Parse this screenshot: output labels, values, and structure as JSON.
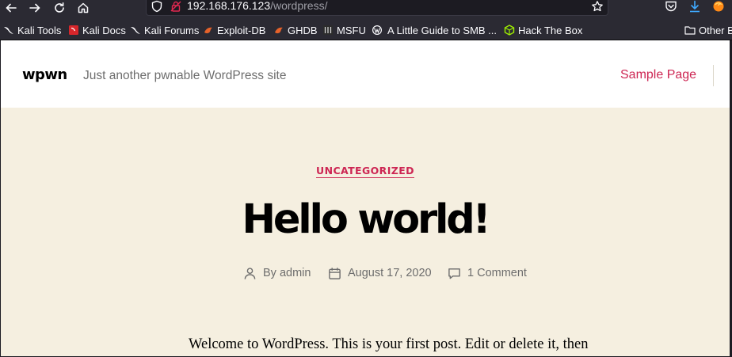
{
  "browser": {
    "url_host": "192.168.176.123",
    "url_path": "/wordpress/",
    "bookmarks": [
      {
        "label": "Kali Tools",
        "icon": "kali-dragon-icon"
      },
      {
        "label": "Kali Docs",
        "icon": "kali-docs-icon"
      },
      {
        "label": "Kali Forums",
        "icon": "kali-dragon-icon"
      },
      {
        "label": "Exploit-DB",
        "icon": "exploit-db-icon"
      },
      {
        "label": "GHDB",
        "icon": "ghdb-icon"
      },
      {
        "label": "MSFU",
        "icon": "msfu-icon"
      },
      {
        "label": "A Little Guide to SMB ...",
        "icon": "wordpress-icon"
      },
      {
        "label": "Hack The Box",
        "icon": "hackthebox-icon"
      },
      {
        "label": "Other B",
        "icon": "folder-icon"
      }
    ]
  },
  "site": {
    "title": "wpwn",
    "description": "Just another pwnable WordPress site",
    "menu": [
      "Sample Page"
    ]
  },
  "post": {
    "category": "UNCATEGORIZED",
    "title": "Hello world!",
    "author": "By admin",
    "date": "August 17, 2020",
    "comments": "1 Comment",
    "excerpt": "Welcome to WordPress. This is your first post. Edit or delete it, then"
  },
  "colors": {
    "accent": "#cd2653",
    "background": "#f5efe0",
    "chrome": "#2b2a33"
  }
}
